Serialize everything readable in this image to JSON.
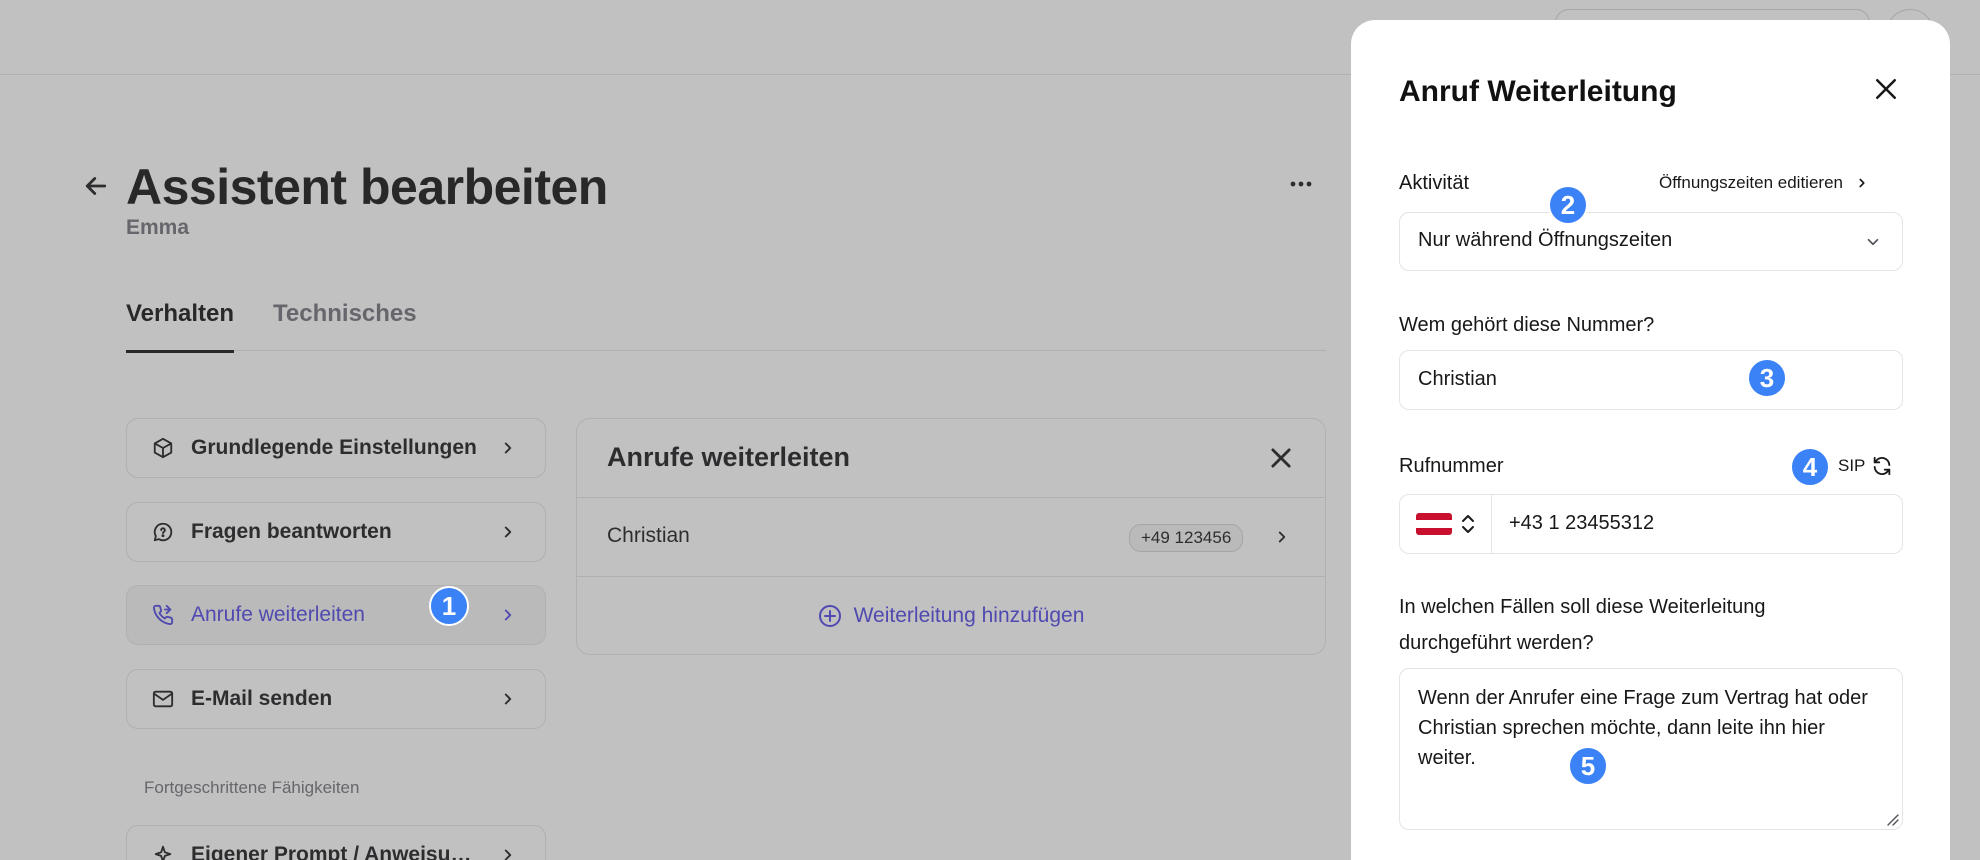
{
  "page": {
    "title": "Assistent bearbeiten",
    "subtitle": "Emma",
    "tabs": [
      "Verhalten",
      "Technisches"
    ]
  },
  "sidebar": {
    "items": [
      {
        "label": "Grundlegende Einstellungen",
        "icon": "box-icon"
      },
      {
        "label": "Fragen beantworten",
        "icon": "chat-question-icon"
      },
      {
        "label": "Anrufe weiterleiten",
        "icon": "phone-forward-icon",
        "active": true
      },
      {
        "label": "E-Mail senden",
        "icon": "mail-icon"
      }
    ],
    "section_label": "Fortgeschrittene Fähigkeiten",
    "advanced_items": [
      {
        "label": "Eigener Prompt / Anweisungen",
        "icon": "sparkle-icon"
      }
    ]
  },
  "forwarding_panel": {
    "title": "Anrufe weiterleiten",
    "rows": [
      {
        "name": "Christian",
        "number": "+49 123456"
      }
    ],
    "add_label": "Weiterleitung hinzufügen"
  },
  "drawer": {
    "title": "Anruf Weiterleitung",
    "activity_label": "Aktivität",
    "activity_link": "Öffnungszeiten editieren",
    "activity_value": "Nur während Öffnungszeiten",
    "owner_label": "Wem gehört diese Nummer?",
    "owner_value": "Christian",
    "phone_label": "Rufnummer",
    "sip_label": "SIP",
    "phone_value": "+43 1 23455312",
    "country_flag": "austria-flag-icon",
    "cases_label_line1": "In welchen Fällen soll diese Weiterleitung",
    "cases_label_line2": "durchgeführt werden?",
    "cases_value": "Wenn der Anrufer eine Frage zum Vertrag hat oder Christian sprechen möchte, dann leite ihn hier weiter."
  },
  "markers": [
    "1",
    "2",
    "3",
    "4",
    "5"
  ],
  "colors": {
    "accent": "#4f46e5",
    "marker": "#3b82f6",
    "flag_red": "#c8102e"
  }
}
